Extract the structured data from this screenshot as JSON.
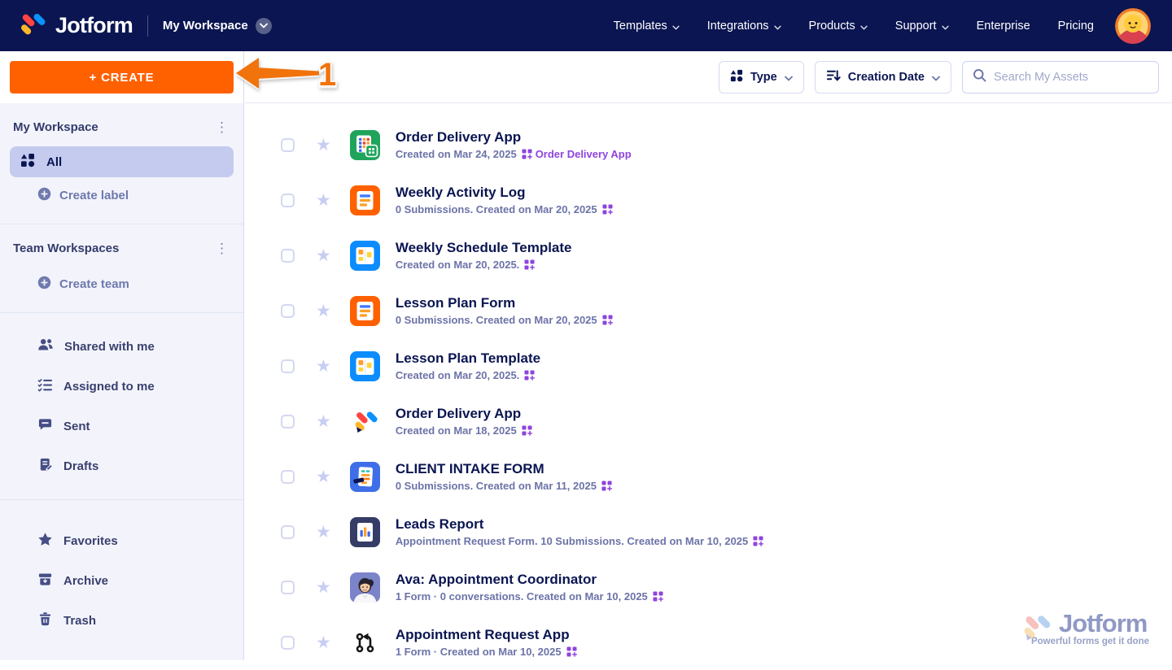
{
  "navbar": {
    "brand": "Jotform",
    "workspace": "My Workspace",
    "items": [
      {
        "label": "Templates",
        "chevron": true
      },
      {
        "label": "Integrations",
        "chevron": true
      },
      {
        "label": "Products",
        "chevron": true
      },
      {
        "label": "Support",
        "chevron": true
      },
      {
        "label": "Enterprise",
        "chevron": false
      },
      {
        "label": "Pricing",
        "chevron": false
      }
    ]
  },
  "sidebar": {
    "create_button": "+ CREATE",
    "my_workspace": {
      "title": "My Workspace",
      "all_label": "All",
      "create_label": "Create label"
    },
    "team_workspaces": {
      "title": "Team Workspaces",
      "create_team": "Create team"
    },
    "nav_items": [
      {
        "label": "Shared with me"
      },
      {
        "label": "Assigned to me"
      },
      {
        "label": "Sent"
      },
      {
        "label": "Drafts"
      }
    ],
    "bottom_items": [
      {
        "label": "Favorites"
      },
      {
        "label": "Archive"
      },
      {
        "label": "Trash"
      }
    ]
  },
  "toolbar": {
    "type_label": "Type",
    "sort_label": "Creation Date",
    "search_placeholder": "Search My Assets"
  },
  "list": {
    "rows": [
      {
        "title": "Order Delivery App",
        "subtitle": "Created on Mar 24, 2025",
        "link": "Order Delivery App",
        "icon": "app-green"
      },
      {
        "title": "Weekly Activity Log",
        "subtitle": "0 Submissions. Created on Mar 20, 2025",
        "icon": "form-orange"
      },
      {
        "title": "Weekly Schedule Template",
        "subtitle": "Created on Mar 20, 2025.",
        "icon": "board-blue"
      },
      {
        "title": "Lesson Plan Form",
        "subtitle": "0 Submissions. Created on Mar 20, 2025",
        "icon": "form-orange"
      },
      {
        "title": "Lesson Plan Template",
        "subtitle": "Created on Mar 20, 2025.",
        "icon": "board-blue"
      },
      {
        "title": "Order Delivery App",
        "subtitle": "Created on Mar 18, 2025",
        "icon": "jotform-mark"
      },
      {
        "title": "CLIENT INTAKE FORM",
        "subtitle": "0 Submissions. Created on Mar 11, 2025",
        "icon": "doc-blue"
      },
      {
        "title": "Leads Report",
        "subtitle": "Appointment Request Form. 10 Submissions. Created on Mar 10, 2025",
        "icon": "report-navy"
      },
      {
        "title": "Ava: Appointment Coordinator",
        "subtitle": "1 Form · 0 conversations. Created on Mar 10, 2025",
        "icon": "avatar-photo"
      },
      {
        "title": "Appointment Request App",
        "subtitle": "1 Form · Created on Mar 10, 2025",
        "icon": "git-compare"
      }
    ]
  },
  "annotation": {
    "step_number": "1"
  },
  "watermark": {
    "brand": "Jotform",
    "tagline": "Powerful forms get it done"
  },
  "colors": {
    "navbar_bg": "#0a1551",
    "accent_orange": "#ff6100",
    "link_purple": "#8e44dd",
    "title_navy": "#0a1551",
    "subtitle_gray": "#6c73a8",
    "sidebar_bg": "#f3f4fb",
    "sidebar_selected": "#c4cbef"
  }
}
